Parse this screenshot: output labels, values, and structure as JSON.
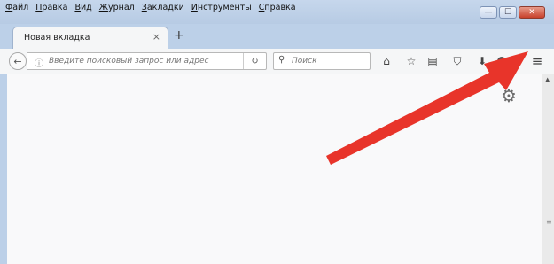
{
  "menu": {
    "items": [
      "Файл",
      "Правка",
      "Вид",
      "Журнал",
      "Закладки",
      "Инструменты",
      "Справка"
    ]
  },
  "window": {
    "minimize": "—",
    "maximize": "☐",
    "close": "✕"
  },
  "tabs": [
    {
      "label": "Новая вкладка",
      "close": "×"
    }
  ],
  "newtab_label": "+",
  "nav": {
    "back_icon": "←",
    "info_icon": "ⓘ",
    "url_placeholder": "Введите поисковый запрос или адрес",
    "reload_icon": "↻",
    "search_icon": "⚲",
    "search_placeholder": "Поиск",
    "icons": [
      "home-icon",
      "star-icon",
      "reading-list-icon",
      "pocket-icon",
      "download-icon",
      "hamburger-menu-icon"
    ]
  },
  "glyphs": {
    "home": "⌂",
    "star": "☆",
    "reading": "▤",
    "pocket": "⛉",
    "download": "⬇",
    "menu": "≡",
    "gear": "⚙",
    "scroll_up": "▲",
    "grip": "≡"
  },
  "colors": {
    "arrow": "#e8342a",
    "chrome": "#bcd0e8",
    "toolbar": "#f5f6f7"
  }
}
